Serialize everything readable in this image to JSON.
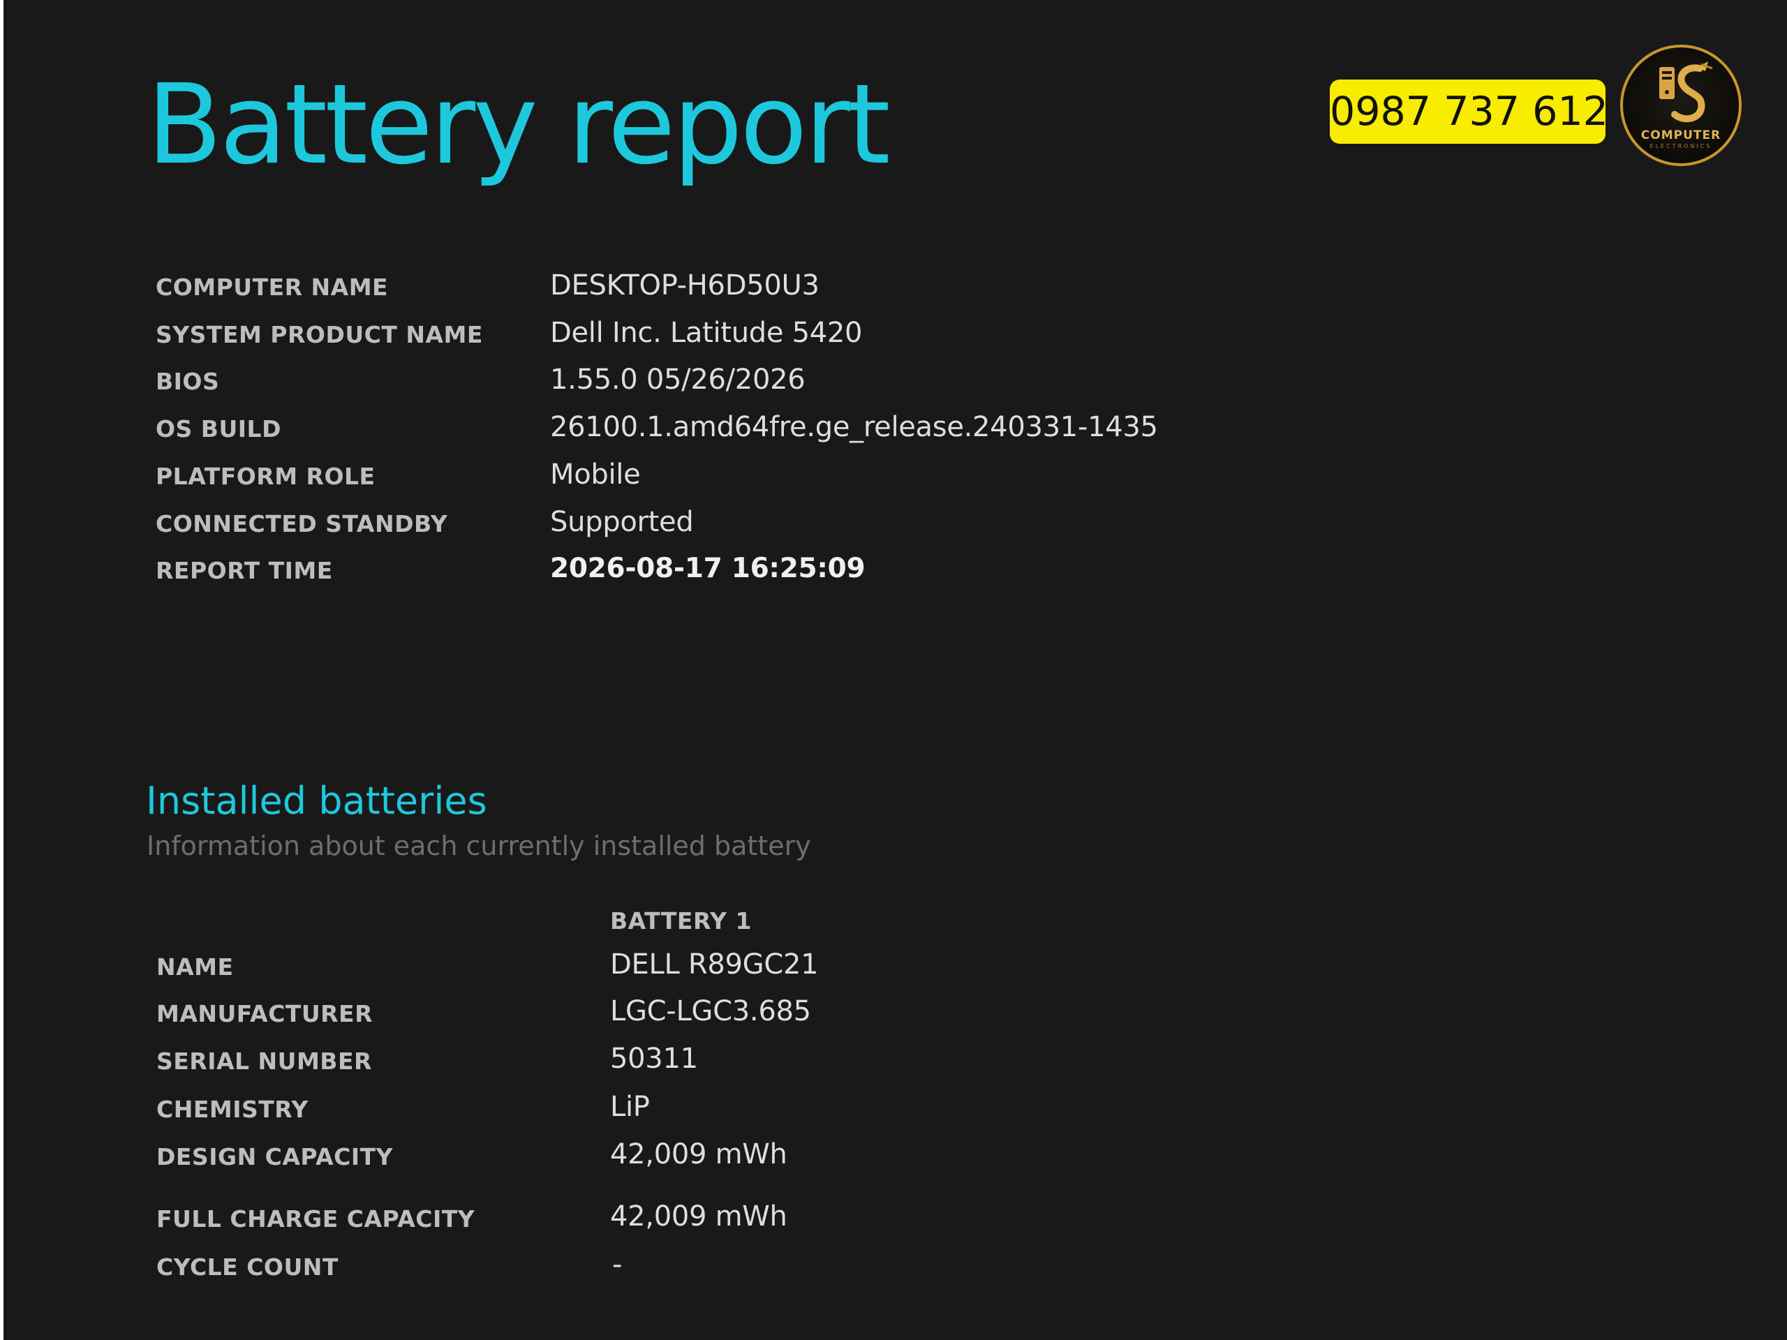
{
  "report": {
    "title": "Battery report"
  },
  "badge": {
    "phone": "0987 737 612",
    "logo_text": "COMPUTER",
    "logo_subtext": "ELECTRONICS"
  },
  "system_info": [
    {
      "label": "COMPUTER NAME",
      "value": "DESKTOP-H6D50U3"
    },
    {
      "label": "SYSTEM PRODUCT NAME",
      "value": "Dell Inc. Latitude 5420"
    },
    {
      "label": "BIOS",
      "value": "1.55.0 05/26/2026"
    },
    {
      "label": "OS BUILD",
      "value": "26100.1.amd64fre.ge_release.240331-1435"
    },
    {
      "label": "PLATFORM ROLE",
      "value": "Mobile"
    },
    {
      "label": "CONNECTED STANDBY",
      "value": "Supported"
    },
    {
      "label": "REPORT TIME",
      "value": "2026-08-17  16:25:09"
    }
  ],
  "installed_batteries": {
    "title": "Installed batteries",
    "subtitle": "Information about each currently installed battery",
    "column_header": "BATTERY 1",
    "rows": [
      {
        "label": "NAME",
        "value": "DELL R89GC21"
      },
      {
        "label": "MANUFACTURER",
        "value": "LGC-LGC3.685"
      },
      {
        "label": "SERIAL NUMBER",
        "value": "50311"
      },
      {
        "label": "CHEMISTRY",
        "value": "LiP"
      },
      {
        "label": "DESIGN CAPACITY",
        "value": "42,009 mWh"
      },
      {
        "label": "FULL CHARGE CAPACITY",
        "value": "42,009 mWh"
      },
      {
        "label": "CYCLE COUNT",
        "value": "-"
      }
    ]
  },
  "colors": {
    "background": "#191919",
    "accent": "#1ec8dc",
    "badge": "#f8ec00",
    "logo_gold": "#c8962d"
  }
}
